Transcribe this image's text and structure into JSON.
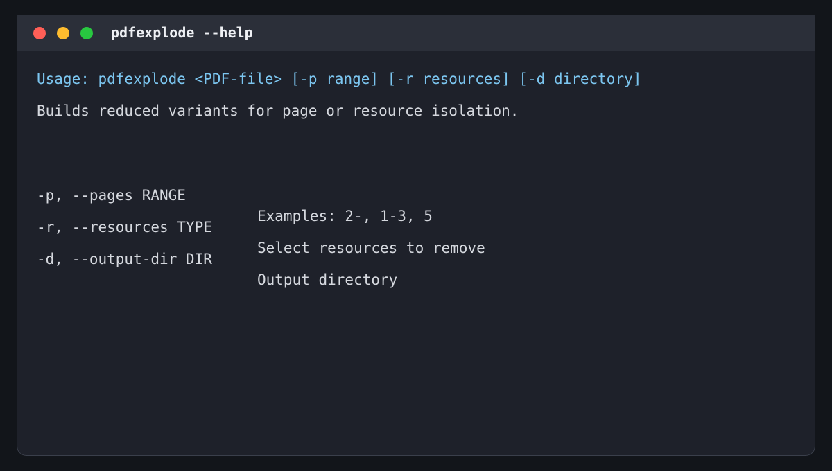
{
  "window": {
    "title": "pdfexplode --help"
  },
  "terminal": {
    "usage": "Usage: pdfexplode <PDF-file> [-p range] [-r resources] [-d directory]",
    "description": "Builds reduced variants for page or resource isolation.",
    "options": [
      {
        "flag": "-p, --pages RANGE",
        "desc": "Examples: 2-, 1-3, 5"
      },
      {
        "flag": "-r, --resources TYPE",
        "desc": "Select resources to remove"
      },
      {
        "flag": "-d, --output-dir DIR",
        "desc": "Output directory"
      }
    ]
  },
  "colors": {
    "background": "#1e212a",
    "titlebar": "#2b2f39",
    "usage_text": "#7cc6f0",
    "body_text": "#d5d8de",
    "close": "#ff5f57",
    "minimize": "#febc2e",
    "maximize": "#28c840"
  }
}
